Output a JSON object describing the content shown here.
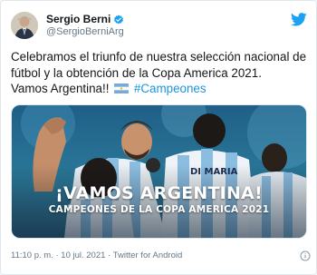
{
  "tweet": {
    "author": {
      "display_name": "Sergio Berni",
      "handle": "@SergioBerniArg",
      "verified": true
    },
    "text_line1": "Celebramos el triunfo de nuestra selección nacional de",
    "text_line2": "fútbol y la obtención de la Copa America 2021.",
    "text_line3": "Vamos Argentina!!",
    "hashtag": "#Campeones",
    "media": {
      "headline": "¡VAMOS ARGENTINA!",
      "subheadline": "CAMPEONES DE LA COPA AMERICA 2021"
    },
    "time": "11:10 p. m.",
    "separator": "·",
    "date": "10 jul. 2021",
    "source": "Twitter for Android"
  },
  "colors": {
    "brand": "#1da1f2",
    "hashtag": "#1b95e0",
    "text": "#14171a",
    "muted": "#657786"
  },
  "icons": {
    "logo": "twitter-bird-icon",
    "verified": "verified-badge-icon",
    "flag": "argentina-flag-icon",
    "info": "info-icon"
  }
}
